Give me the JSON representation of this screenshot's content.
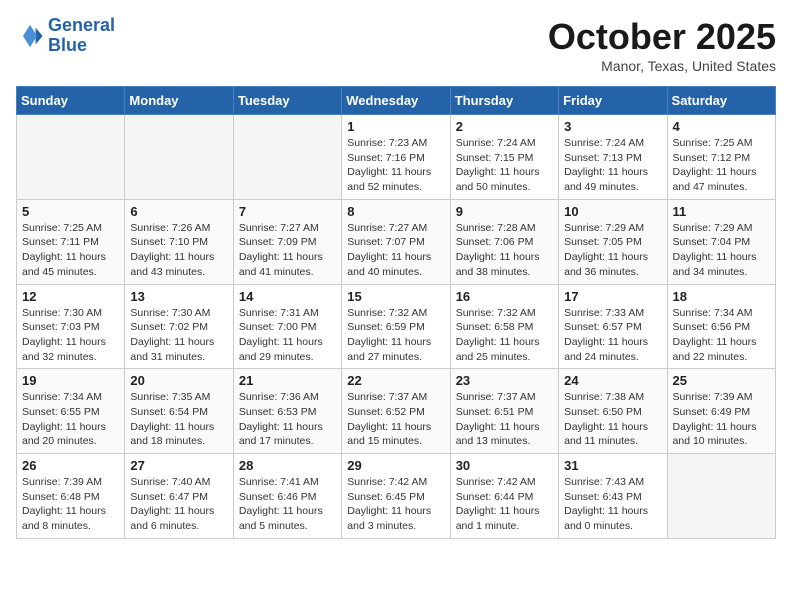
{
  "header": {
    "logo_line1": "General",
    "logo_line2": "Blue",
    "month_title": "October 2025",
    "location": "Manor, Texas, United States"
  },
  "days_of_week": [
    "Sunday",
    "Monday",
    "Tuesday",
    "Wednesday",
    "Thursday",
    "Friday",
    "Saturday"
  ],
  "weeks": [
    [
      {
        "day": "",
        "empty": true
      },
      {
        "day": "",
        "empty": true
      },
      {
        "day": "",
        "empty": true
      },
      {
        "day": "1",
        "sunrise": "Sunrise: 7:23 AM",
        "sunset": "Sunset: 7:16 PM",
        "daylight": "Daylight: 11 hours and 52 minutes."
      },
      {
        "day": "2",
        "sunrise": "Sunrise: 7:24 AM",
        "sunset": "Sunset: 7:15 PM",
        "daylight": "Daylight: 11 hours and 50 minutes."
      },
      {
        "day": "3",
        "sunrise": "Sunrise: 7:24 AM",
        "sunset": "Sunset: 7:13 PM",
        "daylight": "Daylight: 11 hours and 49 minutes."
      },
      {
        "day": "4",
        "sunrise": "Sunrise: 7:25 AM",
        "sunset": "Sunset: 7:12 PM",
        "daylight": "Daylight: 11 hours and 47 minutes."
      }
    ],
    [
      {
        "day": "5",
        "sunrise": "Sunrise: 7:25 AM",
        "sunset": "Sunset: 7:11 PM",
        "daylight": "Daylight: 11 hours and 45 minutes."
      },
      {
        "day": "6",
        "sunrise": "Sunrise: 7:26 AM",
        "sunset": "Sunset: 7:10 PM",
        "daylight": "Daylight: 11 hours and 43 minutes."
      },
      {
        "day": "7",
        "sunrise": "Sunrise: 7:27 AM",
        "sunset": "Sunset: 7:09 PM",
        "daylight": "Daylight: 11 hours and 41 minutes."
      },
      {
        "day": "8",
        "sunrise": "Sunrise: 7:27 AM",
        "sunset": "Sunset: 7:07 PM",
        "daylight": "Daylight: 11 hours and 40 minutes."
      },
      {
        "day": "9",
        "sunrise": "Sunrise: 7:28 AM",
        "sunset": "Sunset: 7:06 PM",
        "daylight": "Daylight: 11 hours and 38 minutes."
      },
      {
        "day": "10",
        "sunrise": "Sunrise: 7:29 AM",
        "sunset": "Sunset: 7:05 PM",
        "daylight": "Daylight: 11 hours and 36 minutes."
      },
      {
        "day": "11",
        "sunrise": "Sunrise: 7:29 AM",
        "sunset": "Sunset: 7:04 PM",
        "daylight": "Daylight: 11 hours and 34 minutes."
      }
    ],
    [
      {
        "day": "12",
        "sunrise": "Sunrise: 7:30 AM",
        "sunset": "Sunset: 7:03 PM",
        "daylight": "Daylight: 11 hours and 32 minutes."
      },
      {
        "day": "13",
        "sunrise": "Sunrise: 7:30 AM",
        "sunset": "Sunset: 7:02 PM",
        "daylight": "Daylight: 11 hours and 31 minutes."
      },
      {
        "day": "14",
        "sunrise": "Sunrise: 7:31 AM",
        "sunset": "Sunset: 7:00 PM",
        "daylight": "Daylight: 11 hours and 29 minutes."
      },
      {
        "day": "15",
        "sunrise": "Sunrise: 7:32 AM",
        "sunset": "Sunset: 6:59 PM",
        "daylight": "Daylight: 11 hours and 27 minutes."
      },
      {
        "day": "16",
        "sunrise": "Sunrise: 7:32 AM",
        "sunset": "Sunset: 6:58 PM",
        "daylight": "Daylight: 11 hours and 25 minutes."
      },
      {
        "day": "17",
        "sunrise": "Sunrise: 7:33 AM",
        "sunset": "Sunset: 6:57 PM",
        "daylight": "Daylight: 11 hours and 24 minutes."
      },
      {
        "day": "18",
        "sunrise": "Sunrise: 7:34 AM",
        "sunset": "Sunset: 6:56 PM",
        "daylight": "Daylight: 11 hours and 22 minutes."
      }
    ],
    [
      {
        "day": "19",
        "sunrise": "Sunrise: 7:34 AM",
        "sunset": "Sunset: 6:55 PM",
        "daylight": "Daylight: 11 hours and 20 minutes."
      },
      {
        "day": "20",
        "sunrise": "Sunrise: 7:35 AM",
        "sunset": "Sunset: 6:54 PM",
        "daylight": "Daylight: 11 hours and 18 minutes."
      },
      {
        "day": "21",
        "sunrise": "Sunrise: 7:36 AM",
        "sunset": "Sunset: 6:53 PM",
        "daylight": "Daylight: 11 hours and 17 minutes."
      },
      {
        "day": "22",
        "sunrise": "Sunrise: 7:37 AM",
        "sunset": "Sunset: 6:52 PM",
        "daylight": "Daylight: 11 hours and 15 minutes."
      },
      {
        "day": "23",
        "sunrise": "Sunrise: 7:37 AM",
        "sunset": "Sunset: 6:51 PM",
        "daylight": "Daylight: 11 hours and 13 minutes."
      },
      {
        "day": "24",
        "sunrise": "Sunrise: 7:38 AM",
        "sunset": "Sunset: 6:50 PM",
        "daylight": "Daylight: 11 hours and 11 minutes."
      },
      {
        "day": "25",
        "sunrise": "Sunrise: 7:39 AM",
        "sunset": "Sunset: 6:49 PM",
        "daylight": "Daylight: 11 hours and 10 minutes."
      }
    ],
    [
      {
        "day": "26",
        "sunrise": "Sunrise: 7:39 AM",
        "sunset": "Sunset: 6:48 PM",
        "daylight": "Daylight: 11 hours and 8 minutes."
      },
      {
        "day": "27",
        "sunrise": "Sunrise: 7:40 AM",
        "sunset": "Sunset: 6:47 PM",
        "daylight": "Daylight: 11 hours and 6 minutes."
      },
      {
        "day": "28",
        "sunrise": "Sunrise: 7:41 AM",
        "sunset": "Sunset: 6:46 PM",
        "daylight": "Daylight: 11 hours and 5 minutes."
      },
      {
        "day": "29",
        "sunrise": "Sunrise: 7:42 AM",
        "sunset": "Sunset: 6:45 PM",
        "daylight": "Daylight: 11 hours and 3 minutes."
      },
      {
        "day": "30",
        "sunrise": "Sunrise: 7:42 AM",
        "sunset": "Sunset: 6:44 PM",
        "daylight": "Daylight: 11 hours and 1 minute."
      },
      {
        "day": "31",
        "sunrise": "Sunrise: 7:43 AM",
        "sunset": "Sunset: 6:43 PM",
        "daylight": "Daylight: 11 hours and 0 minutes."
      },
      {
        "day": "",
        "empty": true
      }
    ]
  ]
}
